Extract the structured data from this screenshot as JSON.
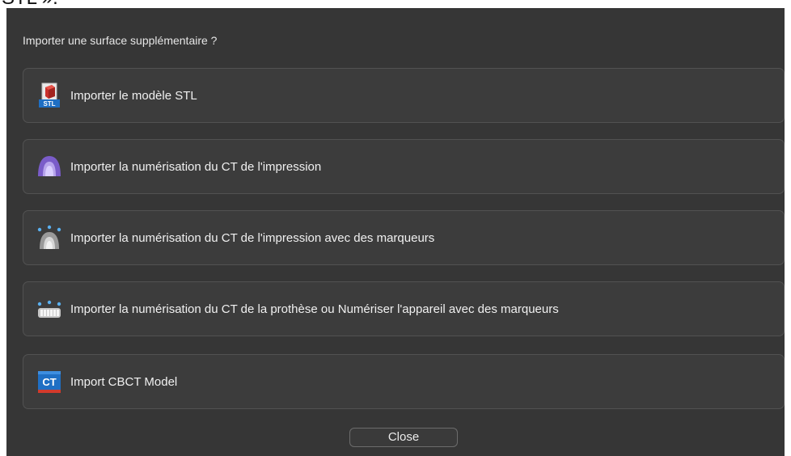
{
  "clipped_heading": "STL ».",
  "dialog": {
    "prompt": "Importer une surface supplémentaire ?",
    "options": [
      {
        "label": "Importer le modèle STL",
        "icon": "stl-file-icon"
      },
      {
        "label": "Importer la numérisation du CT de l'impression",
        "icon": "impression-tray-icon"
      },
      {
        "label": "Importer la numérisation du CT de l'impression avec des marqueurs",
        "icon": "impression-markers-icon"
      },
      {
        "label": "Importer la numérisation du CT de la prothèse ou Numériser l'appareil avec des marqueurs",
        "icon": "denture-markers-icon"
      },
      {
        "label": "Import CBCT Model",
        "icon": "cbct-icon"
      }
    ],
    "close_label": "Close"
  },
  "colors": {
    "dialog_bg": "#363636",
    "option_bg": "#3c3c3c",
    "option_border": "#525252",
    "text": "#f0f0f0",
    "accent_blue": "#1f6fc4",
    "accent_red": "#d23a2c",
    "impression_purple": "#7a5cc9"
  }
}
